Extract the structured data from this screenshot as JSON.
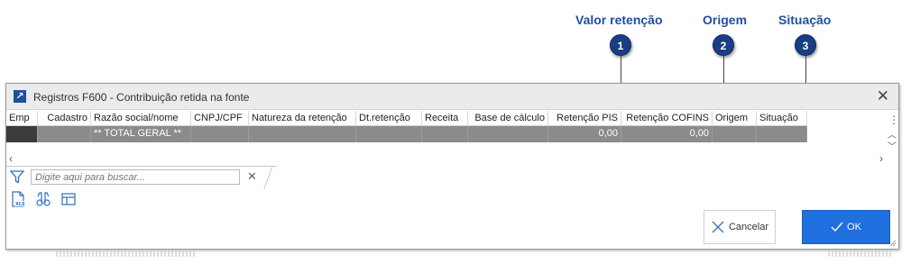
{
  "callouts": [
    {
      "number": "1",
      "label": "Valor retenção"
    },
    {
      "number": "2",
      "label": "Origem"
    },
    {
      "number": "3",
      "label": "Situação"
    }
  ],
  "window": {
    "title": "Registros F600 - Contribuição retida na fonte",
    "close_symbol": "✕"
  },
  "grid": {
    "columns": [
      "Emp",
      "Cadastro",
      "Razão social/nome",
      "CNPJ/CPF",
      "Natureza da retenção",
      "Dt.retenção",
      "Receita",
      "Base de cálculo",
      "Retenção PIS",
      "Retenção COFINS",
      "Origem",
      "Situação"
    ],
    "total_row": {
      "emp": "",
      "cadastro": "",
      "razao": "** TOTAL GERAL **",
      "cnpj": "",
      "natureza": "",
      "dt": "",
      "receita": "",
      "base": "",
      "pis": "0,00",
      "cofins": "0,00",
      "origem": "",
      "situacao": ""
    }
  },
  "search": {
    "placeholder": "Digite aqui para buscar..."
  },
  "buttons": {
    "cancel": "Cancelar",
    "ok": "OK"
  },
  "icons": {
    "app": "arrow-up-right-icon",
    "filter": "funnel-icon",
    "export": "xls-export-icon",
    "find": "binoculars-icon",
    "layout": "layout-icon"
  },
  "colors": {
    "accent": "#1f6fdf",
    "callout": "#1a3e85",
    "total_row": "#8b8b8b"
  }
}
